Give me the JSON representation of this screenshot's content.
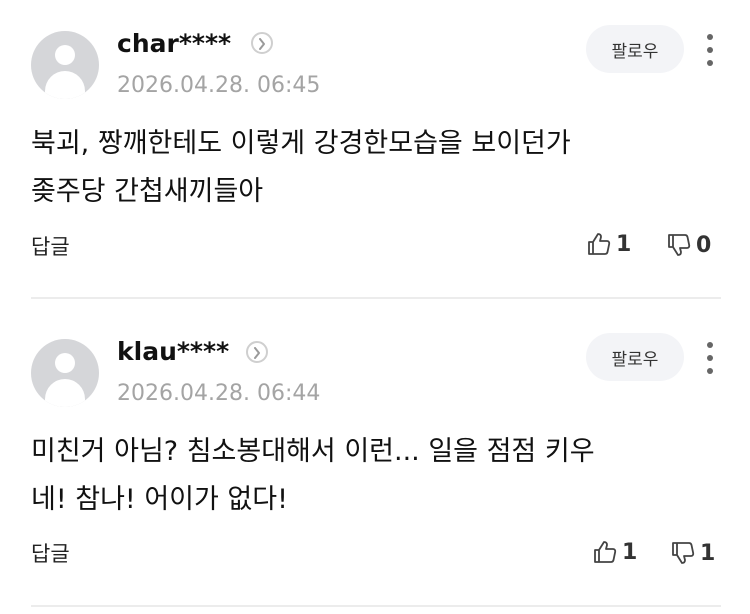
{
  "comments": [
    {
      "username": "char****",
      "timestamp": "2026.04.28. 06:45",
      "follow_label": "팔로우",
      "text_lines": [
        "북괴, 짱깨한테도 이렇게 강경한모습을 보이던가",
        "좆주당 간첩새끼들아"
      ],
      "reply_label": "답글",
      "likes": "1",
      "dislikes": "0"
    },
    {
      "username": "klau****",
      "timestamp": "2026.04.28. 06:44",
      "follow_label": "팔로우",
      "text_lines": [
        "미친거 아님? 침소봉대해서 이런... 일을 점점 키우",
        "네! 참나! 어이가 없다!"
      ],
      "reply_label": "답글",
      "likes": "1",
      "dislikes": "1"
    }
  ],
  "icons": {
    "avatar": "default-user-avatar",
    "profile_link": "chevron-right-circle-icon",
    "more": "vertical-ellipsis-icon",
    "like": "thumbs-up-icon",
    "dislike": "thumbs-down-icon"
  },
  "colors": {
    "timestamp": "#a4a4a4",
    "follow_bg": "#f3f4f7",
    "avatar_bg": "#d5d6d9",
    "divider": "#ececec"
  }
}
